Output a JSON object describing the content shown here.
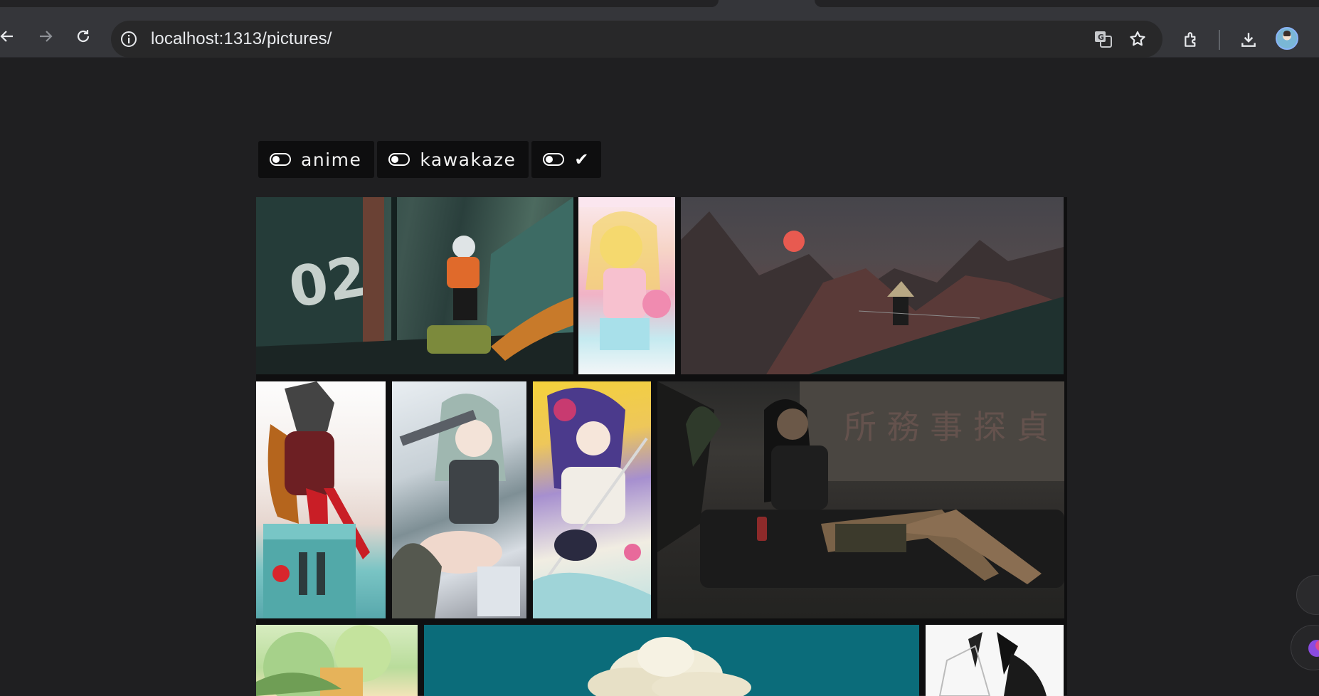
{
  "browser": {
    "url_host": "localhost",
    "url_rest": ":1313/pictures/",
    "icons": [
      "back-icon",
      "forward-icon",
      "reload-icon",
      "site-info-icon",
      "translate-icon",
      "bookmark-star-icon",
      "extensions-icon",
      "download-icon",
      "profile-avatar"
    ]
  },
  "filters": [
    {
      "label": "anime",
      "enabled": true
    },
    {
      "label": "kawakaze",
      "enabled": true
    },
    {
      "label": "✔",
      "enabled": true
    }
  ],
  "gallery": {
    "rows": [
      [
        "eva-02-girl-with-bazooka",
        "swimsuit-girl-with-flamingo-float",
        "samurai-on-mountain-red-moon"
      ],
      [
        "asuka-plugsuit-on-building",
        "grey-haired-girl-with-gun",
        "purple-haired-girl-with-sword",
        "woman-lounging-on-couch"
      ],
      [
        "green-character-art",
        "cloud-over-teal-sky",
        "white-horned-character"
      ]
    ]
  },
  "colors": {
    "page_bg": "#1f1f21",
    "chrome_bg": "#35363a",
    "chip_bg": "#0e0e0f"
  }
}
